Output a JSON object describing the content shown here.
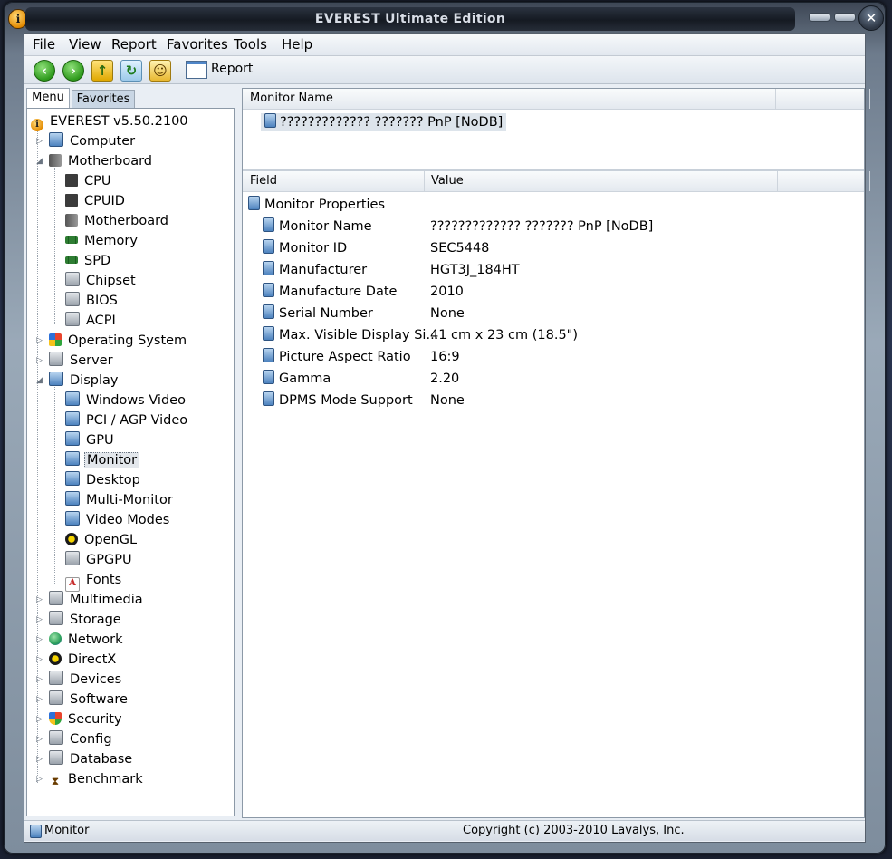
{
  "window": {
    "title": "EVEREST Ultimate Edition"
  },
  "menubar": [
    {
      "label": "File"
    },
    {
      "label": "View"
    },
    {
      "label": "Report"
    },
    {
      "label": "Favorites"
    },
    {
      "label": "Tools"
    },
    {
      "label": "Help"
    }
  ],
  "toolbar": {
    "report_label": "Report"
  },
  "tabs": {
    "menu": "Menu",
    "favorites": "Favorites"
  },
  "tree": {
    "root": "EVEREST v5.50.2100",
    "items": [
      {
        "label": "Computer",
        "icon": "computer-icon"
      },
      {
        "label": "Motherboard",
        "icon": "motherboard-icon"
      },
      {
        "label": "CPU",
        "icon": "cpu-icon"
      },
      {
        "label": "CPUID",
        "icon": "cpu-icon"
      },
      {
        "label": "Motherboard",
        "icon": "motherboard-icon"
      },
      {
        "label": "Memory",
        "icon": "memory-icon"
      },
      {
        "label": "SPD",
        "icon": "memory-icon"
      },
      {
        "label": "Chipset",
        "icon": "chip-icon"
      },
      {
        "label": "BIOS",
        "icon": "chip-icon"
      },
      {
        "label": "ACPI",
        "icon": "chip-icon"
      },
      {
        "label": "Operating System",
        "icon": "windows-icon"
      },
      {
        "label": "Server",
        "icon": "server-icon"
      },
      {
        "label": "Display",
        "icon": "display-icon"
      },
      {
        "label": "Windows Video",
        "icon": "monitor-icon"
      },
      {
        "label": "PCI / AGP Video",
        "icon": "monitor-icon"
      },
      {
        "label": "GPU",
        "icon": "monitor-icon"
      },
      {
        "label": "Monitor",
        "icon": "monitor-icon"
      },
      {
        "label": "Desktop",
        "icon": "desktop-icon"
      },
      {
        "label": "Multi-Monitor",
        "icon": "monitor-icon"
      },
      {
        "label": "Video Modes",
        "icon": "monitor-icon"
      },
      {
        "label": "OpenGL",
        "icon": "opengl-icon"
      },
      {
        "label": "GPGPU",
        "icon": "gpgpu-icon"
      },
      {
        "label": "Fonts",
        "icon": "font-icon"
      },
      {
        "label": "Multimedia",
        "icon": "multimedia-icon"
      },
      {
        "label": "Storage",
        "icon": "storage-icon"
      },
      {
        "label": "Network",
        "icon": "network-icon"
      },
      {
        "label": "DirectX",
        "icon": "directx-icon"
      },
      {
        "label": "Devices",
        "icon": "devices-icon"
      },
      {
        "label": "Software",
        "icon": "software-icon"
      },
      {
        "label": "Security",
        "icon": "security-icon"
      },
      {
        "label": "Config",
        "icon": "config-icon"
      },
      {
        "label": "Database",
        "icon": "database-icon"
      },
      {
        "label": "Benchmark",
        "icon": "benchmark-icon"
      }
    ]
  },
  "upper_list": {
    "header": "Monitor Name",
    "rows": [
      "????????????? ??????? PnP [NoDB]"
    ]
  },
  "details": {
    "headers": {
      "field": "Field",
      "value": "Value"
    },
    "group": "Monitor Properties",
    "rows": [
      {
        "field": "Monitor Name",
        "value": "????????????? ??????? PnP [NoDB]"
      },
      {
        "field": "Monitor ID",
        "value": "SEC5448"
      },
      {
        "field": "Manufacturer",
        "value": "HGT3J_184HT"
      },
      {
        "field": "Manufacture Date",
        "value": "2010"
      },
      {
        "field": "Serial Number",
        "value": "None"
      },
      {
        "field": "Max. Visible Display Si...",
        "value": "41 cm x 23 cm (18.5\")"
      },
      {
        "field": "Picture Aspect Ratio",
        "value": "16:9"
      },
      {
        "field": "Gamma",
        "value": "2.20"
      },
      {
        "field": "DPMS Mode Support",
        "value": "None"
      }
    ]
  },
  "status": {
    "left": "Monitor",
    "right": "Copyright (c) 2003-2010 Lavalys, Inc."
  }
}
